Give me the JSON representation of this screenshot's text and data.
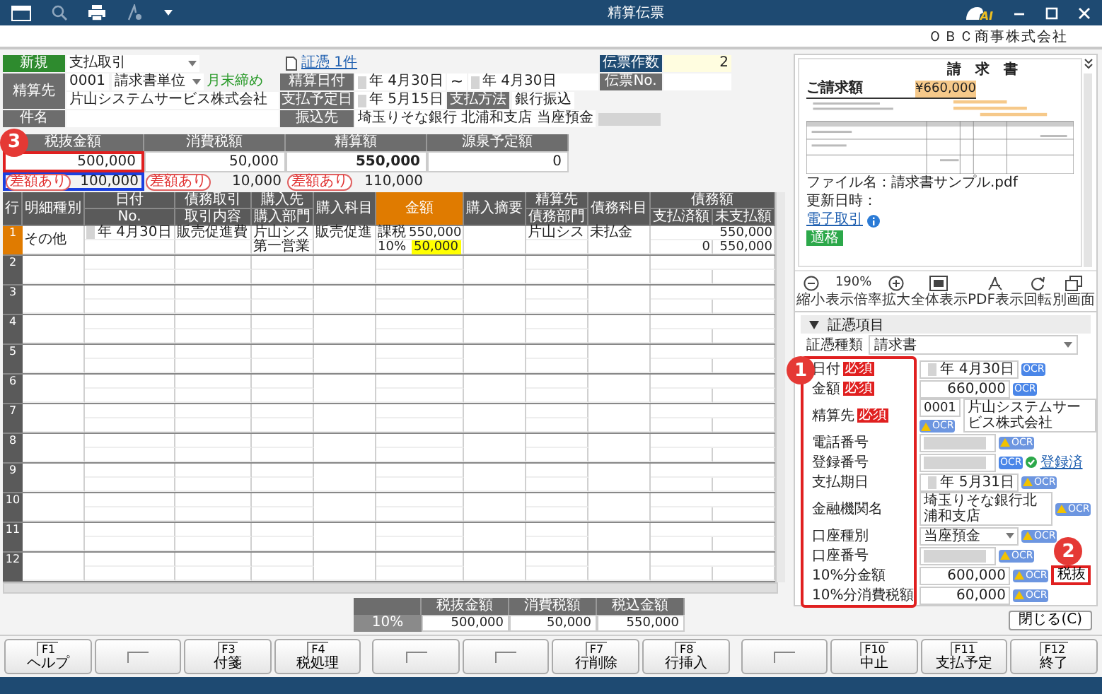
{
  "window": {
    "title": "精算伝票",
    "assistant_label": "AI",
    "company": "ＯＢＣ商事株式会社"
  },
  "header": {
    "mode": "新規",
    "transaction_type": "支払取引",
    "evidence_link": "証憑 1件",
    "voucher_count_label": "伝票作数",
    "voucher_count": "2",
    "voucher_no_label": "伝票No.",
    "payee_label": "精算先",
    "payee_code": "0001",
    "billing_unit": "請求書単位",
    "closing": "月末締め",
    "payee_name": "片山システムサービス株式会社",
    "subject_label": "件名",
    "settlement_date_label": "精算日付",
    "date_from": "年 4月30日",
    "range_sep": "~",
    "date_to": "年 4月30日",
    "due_date_label": "支払予定日",
    "due_date": "年 5月15日",
    "method_label": "支払方法",
    "method": "銀行振込",
    "bank_label": "振込先",
    "bank": "埼玉りそな銀行 北浦和支店 当座預金"
  },
  "summary": {
    "columns": [
      "税抜金額",
      "消費税額",
      "精算額",
      "源泉予定額"
    ],
    "values": [
      "500,000",
      "50,000",
      "550,000",
      "0"
    ],
    "differences": [
      {
        "badge": "差額あり",
        "value": "100,000"
      },
      {
        "badge": "差額あり",
        "value": "10,000"
      },
      {
        "badge": "差額あり",
        "value": "110,000"
      }
    ]
  },
  "callouts": [
    "3",
    "1",
    "2"
  ],
  "table": {
    "columns": [
      {
        "label": "行",
        "highlighted": false
      },
      {
        "label": "明細種別",
        "highlighted": false
      },
      {
        "label": "日付",
        "sub": "No.",
        "highlighted": false
      },
      {
        "label": "債務取引",
        "sub": "取引内容",
        "highlighted": false
      },
      {
        "label": "購入先",
        "sub": "購入部門",
        "highlighted": false
      },
      {
        "label": "購入科目",
        "highlighted": false
      },
      {
        "label": "金額",
        "highlighted": true
      },
      {
        "label": "購入摘要",
        "highlighted": false
      },
      {
        "label": "精算先",
        "sub": "債務部門",
        "highlighted": false
      },
      {
        "label": "債務科目",
        "highlighted": false
      },
      {
        "label": "債務額",
        "subs": [
          "支払済額",
          "未支払額"
        ],
        "highlighted": false
      }
    ],
    "rows": [
      {
        "number": "1",
        "selected": true,
        "type": "その他",
        "date": "年 4月30日",
        "transaction": "販売促進費",
        "vendor": "片山シス",
        "vendor_dept": "第一営業",
        "account": "販売促進",
        "tax_class": "課税",
        "amount": "550,000",
        "tax_rate": "10%",
        "tax": "50,000",
        "tax_highlighted": true,
        "payee": "片山シス",
        "debt_account": "未払金",
        "debt_total": "550,000",
        "paid": "0",
        "unpaid": "550,000"
      },
      {
        "number": "2",
        "selected": false
      },
      {
        "number": "3",
        "selected": false
      },
      {
        "number": "4",
        "selected": false
      },
      {
        "number": "5",
        "selected": false
      },
      {
        "number": "6",
        "selected": false
      },
      {
        "number": "7",
        "selected": false
      },
      {
        "number": "8",
        "selected": false
      },
      {
        "number": "9",
        "selected": false
      },
      {
        "number": "10",
        "selected": false
      },
      {
        "number": "11",
        "selected": false
      },
      {
        "number": "12",
        "selected": false
      }
    ]
  },
  "totals": {
    "columns": [
      "税抜金額",
      "消費税額",
      "税込金額"
    ],
    "rows": [
      {
        "rate": "10%",
        "values": [
          "500,000",
          "50,000",
          "550,000"
        ]
      }
    ]
  },
  "preview": {
    "title": "請　求　書",
    "amount_label": "ご請求額",
    "amount": "¥660,000",
    "file_name": "ファイル名：請求書サンプル.pdf",
    "updated": "更新日時：",
    "link": "電子取引",
    "badge": "適格",
    "zoom": "190%",
    "tools": [
      {
        "kind": "zoom_out",
        "label": "縮小"
      },
      {
        "kind": "zoom_level",
        "label": "表示倍率"
      },
      {
        "kind": "zoom_in",
        "label": "拡大"
      },
      {
        "kind": "fit",
        "label": "全体表示"
      },
      {
        "kind": "pdf",
        "label": "PDF表示"
      },
      {
        "kind": "rotate",
        "label": "回転"
      },
      {
        "kind": "window",
        "label": "別画面"
      }
    ]
  },
  "evidence": {
    "section": "証憑項目",
    "expanded": true,
    "doc_type_label": "証憑種類",
    "doc_type": "請求書",
    "close": "閉じる(C)",
    "fields": [
      {
        "label": "日付",
        "required": "必須",
        "kind": "date",
        "value": "年 4月30日",
        "ocr": "OCR",
        "ocr_warning": false
      },
      {
        "label": "金額",
        "required": "必須",
        "kind": "amount",
        "value": "660,000",
        "ocr": "OCR",
        "ocr_warning": false
      },
      {
        "label": "精算先",
        "required": "必須",
        "kind": "partner",
        "code": "0001",
        "value": "片山システムサービス株式会社",
        "ocr": "OCR",
        "ocr_warning": true
      },
      {
        "label": "電話番号",
        "kind": "masked",
        "ocr": "OCR",
        "ocr_warning": true
      },
      {
        "label": "登録番号",
        "kind": "masked",
        "ocr": "OCR",
        "ocr_warning": false,
        "status": "登録済"
      },
      {
        "label": "支払期日",
        "kind": "date",
        "value": "年 5月31日",
        "ocr": "OCR",
        "ocr_warning": true
      },
      {
        "label": "金融機関名",
        "kind": "text",
        "value": "埼玉りそな銀行北浦和支店",
        "ocr": "OCR",
        "ocr_warning": true
      },
      {
        "label": "口座種別",
        "kind": "select",
        "value": "当座預金",
        "ocr": "OCR",
        "ocr_warning": true
      },
      {
        "label": "口座番号",
        "kind": "masked",
        "ocr": "OCR",
        "ocr_warning": true
      },
      {
        "label": "10%分金額",
        "kind": "amount",
        "value": "600,000",
        "ocr": "OCR",
        "ocr_warning": true,
        "action": "税抜"
      },
      {
        "label": "10%分消費税額",
        "kind": "amount",
        "value": "60,000",
        "ocr": "OCR",
        "ocr_warning": true
      }
    ]
  },
  "function_keys": [
    {
      "kind": "key",
      "key": "F1",
      "label": "ヘルプ"
    },
    {
      "kind": "blank"
    },
    {
      "kind": "key",
      "key": "F3",
      "label": "付箋"
    },
    {
      "kind": "key",
      "key": "F4",
      "label": "税処理"
    },
    {
      "kind": "blank"
    },
    {
      "kind": "blank"
    },
    {
      "kind": "key",
      "key": "F7",
      "label": "行削除"
    },
    {
      "kind": "key",
      "key": "F8",
      "label": "行挿入"
    },
    {
      "kind": "blank"
    },
    {
      "kind": "key",
      "key": "F10",
      "label": "中止"
    },
    {
      "kind": "key",
      "key": "F11",
      "label": "支払予定"
    },
    {
      "kind": "key",
      "key": "F12",
      "label": "終了"
    }
  ]
}
